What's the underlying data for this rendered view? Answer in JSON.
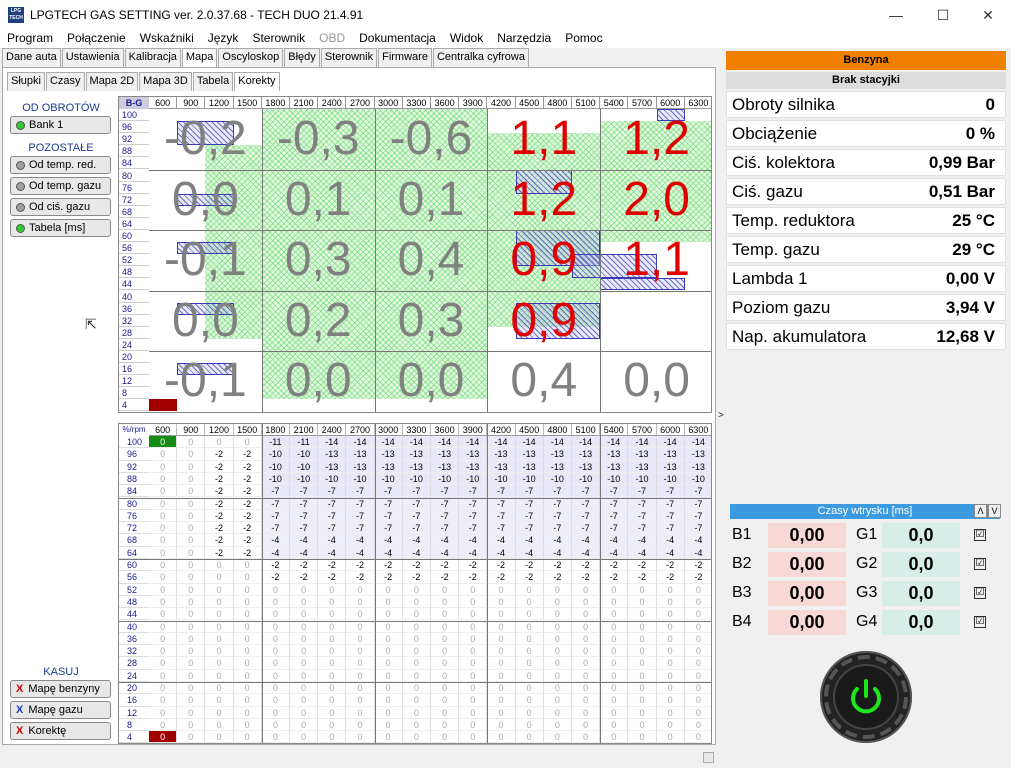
{
  "window": {
    "title": "LPGTECH GAS SETTING ver. 2.0.37.68  -  TECH DUO   21.4.91",
    "icon_text": "LPG TECH",
    "minimize": "—",
    "maximize": "☐",
    "close": "✕"
  },
  "menu": [
    "Program",
    "Połączenie",
    "Wskaźniki",
    "Język",
    "Sterownik",
    "OBD",
    "Dokumentacja",
    "Widok",
    "Narzędzia",
    "Pomoc"
  ],
  "tabs1": [
    "Dane auta",
    "Ustawienia",
    "Kalibracja",
    "Mapa",
    "Oscyloskop",
    "Błędy",
    "Sterownik",
    "Firmware",
    "Centralka cyfrowa"
  ],
  "tabs1_active": "Mapa",
  "tabs2": [
    "Słupki",
    "Czasy",
    "Mapa 2D",
    "Mapa 3D",
    "Tabela",
    "Korekty"
  ],
  "tabs2_active": "Korekty",
  "side": {
    "od_obrotow_title": "OD OBROTÓW",
    "bank_label": "Bank 1",
    "pozostale_title": "POZOSTAŁE",
    "pozostale": [
      {
        "label": "Od temp. red.",
        "dot": "gray"
      },
      {
        "label": "Od temp. gazu",
        "dot": "gray"
      },
      {
        "label": "Od ciś. gazu",
        "dot": "gray"
      },
      {
        "label": "Tabela [ms]",
        "dot": "green"
      }
    ],
    "kasuj_title": "KASUJ",
    "kasuj": [
      {
        "label": "Mapę benzyny",
        "xcolor": "#d00000"
      },
      {
        "label": "Mapę gazu",
        "xcolor": "#1a3fcf"
      },
      {
        "label": "Korektę",
        "xcolor": "#d00000"
      }
    ]
  },
  "map": {
    "corner": "B-G",
    "rpm": [
      "600",
      "900",
      "1200",
      "1500",
      "1800",
      "2100",
      "2400",
      "2700",
      "3000",
      "3300",
      "3600",
      "3900",
      "4200",
      "4500",
      "4800",
      "5100",
      "5400",
      "5700",
      "6000",
      "6300"
    ],
    "loads": [
      "100",
      "96",
      "92",
      "88",
      "84",
      "80",
      "76",
      "72",
      "68",
      "64",
      "60",
      "56",
      "52",
      "48",
      "44",
      "40",
      "36",
      "32",
      "28",
      "24",
      "20",
      "16",
      "12",
      "8",
      "4"
    ],
    "big": [
      [
        {
          "v": "-0,2",
          "c": "gray"
        },
        {
          "v": "-0,3",
          "c": "gray"
        },
        {
          "v": "-0,6",
          "c": "gray"
        },
        {
          "v": "1,1",
          "c": "red"
        },
        {
          "v": "1,2",
          "c": "red"
        }
      ],
      [
        {
          "v": "0,0",
          "c": "gray"
        },
        {
          "v": "0,1",
          "c": "gray"
        },
        {
          "v": "0,1",
          "c": "gray"
        },
        {
          "v": "1,2",
          "c": "red"
        },
        {
          "v": "2,0",
          "c": "red"
        }
      ],
      [
        {
          "v": "-0,1",
          "c": "gray"
        },
        {
          "v": "0,3",
          "c": "gray"
        },
        {
          "v": "0,4",
          "c": "gray"
        },
        {
          "v": "0,9",
          "c": "red"
        },
        {
          "v": "1,1",
          "c": "red"
        }
      ],
      [
        {
          "v": "0,0",
          "c": "gray"
        },
        {
          "v": "0,2",
          "c": "gray"
        },
        {
          "v": "0,3",
          "c": "gray"
        },
        {
          "v": "0,9",
          "c": "red"
        },
        {
          "v": "",
          "c": "gray"
        }
      ],
      [
        {
          "v": "-0,1",
          "c": "gray"
        },
        {
          "v": "0,0",
          "c": "gray"
        },
        {
          "v": "0,0",
          "c": "gray"
        },
        {
          "v": "0,4",
          "c": "gray"
        },
        {
          "v": "0,0",
          "c": "gray"
        }
      ]
    ]
  },
  "table": {
    "corner": "%/rpm",
    "rpm": [
      "600",
      "900",
      "1200",
      "1500",
      "1800",
      "2100",
      "2400",
      "2700",
      "3000",
      "3300",
      "3600",
      "3900",
      "4200",
      "4500",
      "4800",
      "5100",
      "5400",
      "5700",
      "6000",
      "6300"
    ],
    "rows": [
      {
        "load": "100",
        "vals": [
          "0",
          "0",
          "0",
          "0",
          "-11",
          "-11",
          "-14",
          "-14",
          "-14",
          "-14",
          "-14",
          "-14",
          "-14",
          "-14",
          "-14",
          "-14",
          "-14",
          "-14",
          "-14",
          "-14"
        ]
      },
      {
        "load": "96",
        "vals": [
          "0",
          "0",
          "-2",
          "-2",
          "-10",
          "-10",
          "-13",
          "-13",
          "-13",
          "-13",
          "-13",
          "-13",
          "-13",
          "-13",
          "-13",
          "-13",
          "-13",
          "-13",
          "-13",
          "-13"
        ]
      },
      {
        "load": "92",
        "vals": [
          "0",
          "0",
          "-2",
          "-2",
          "-10",
          "-10",
          "-13",
          "-13",
          "-13",
          "-13",
          "-13",
          "-13",
          "-13",
          "-13",
          "-13",
          "-13",
          "-13",
          "-13",
          "-13",
          "-13"
        ]
      },
      {
        "load": "88",
        "vals": [
          "0",
          "0",
          "-2",
          "-2",
          "-10",
          "-10",
          "-10",
          "-10",
          "-10",
          "-10",
          "-10",
          "-10",
          "-10",
          "-10",
          "-10",
          "-10",
          "-10",
          "-10",
          "-10",
          "-10"
        ]
      },
      {
        "load": "84",
        "vals": [
          "0",
          "0",
          "-2",
          "-2",
          "-7",
          "-7",
          "-7",
          "-7",
          "-7",
          "-7",
          "-7",
          "-7",
          "-7",
          "-7",
          "-7",
          "-7",
          "-7",
          "-7",
          "-7",
          "-7"
        ]
      },
      {
        "load": "80",
        "vals": [
          "0",
          "0",
          "-2",
          "-2",
          "-7",
          "-7",
          "-7",
          "-7",
          "-7",
          "-7",
          "-7",
          "-7",
          "-7",
          "-7",
          "-7",
          "-7",
          "-7",
          "-7",
          "-7",
          "-7"
        ]
      },
      {
        "load": "76",
        "vals": [
          "0",
          "0",
          "-2",
          "-2",
          "-7",
          "-7",
          "-7",
          "-7",
          "-7",
          "-7",
          "-7",
          "-7",
          "-7",
          "-7",
          "-7",
          "-7",
          "-7",
          "-7",
          "-7",
          "-7"
        ]
      },
      {
        "load": "72",
        "vals": [
          "0",
          "0",
          "-2",
          "-2",
          "-7",
          "-7",
          "-7",
          "-7",
          "-7",
          "-7",
          "-7",
          "-7",
          "-7",
          "-7",
          "-7",
          "-7",
          "-7",
          "-7",
          "-7",
          "-7"
        ]
      },
      {
        "load": "68",
        "vals": [
          "0",
          "0",
          "-2",
          "-2",
          "-4",
          "-4",
          "-4",
          "-4",
          "-4",
          "-4",
          "-4",
          "-4",
          "-4",
          "-4",
          "-4",
          "-4",
          "-4",
          "-4",
          "-4",
          "-4"
        ]
      },
      {
        "load": "64",
        "vals": [
          "0",
          "0",
          "-2",
          "-2",
          "-4",
          "-4",
          "-4",
          "-4",
          "-4",
          "-4",
          "-4",
          "-4",
          "-4",
          "-4",
          "-4",
          "-4",
          "-4",
          "-4",
          "-4",
          "-4"
        ]
      },
      {
        "load": "60",
        "vals": [
          "0",
          "0",
          "0",
          "0",
          "-2",
          "-2",
          "-2",
          "-2",
          "-2",
          "-2",
          "-2",
          "-2",
          "-2",
          "-2",
          "-2",
          "-2",
          "-2",
          "-2",
          "-2",
          "-2"
        ]
      },
      {
        "load": "56",
        "vals": [
          "0",
          "0",
          "0",
          "0",
          "-2",
          "-2",
          "-2",
          "-2",
          "-2",
          "-2",
          "-2",
          "-2",
          "-2",
          "-2",
          "-2",
          "-2",
          "-2",
          "-2",
          "-2",
          "-2"
        ]
      },
      {
        "load": "52",
        "vals": [
          "0",
          "0",
          "0",
          "0",
          "0",
          "0",
          "0",
          "0",
          "0",
          "0",
          "0",
          "0",
          "0",
          "0",
          "0",
          "0",
          "0",
          "0",
          "0",
          "0"
        ]
      },
      {
        "load": "48",
        "vals": [
          "0",
          "0",
          "0",
          "0",
          "0",
          "0",
          "0",
          "0",
          "0",
          "0",
          "0",
          "0",
          "0",
          "0",
          "0",
          "0",
          "0",
          "0",
          "0",
          "0"
        ]
      },
      {
        "load": "44",
        "vals": [
          "0",
          "0",
          "0",
          "0",
          "0",
          "0",
          "0",
          "0",
          "0",
          "0",
          "0",
          "0",
          "0",
          "0",
          "0",
          "0",
          "0",
          "0",
          "0",
          "0"
        ]
      },
      {
        "load": "40",
        "vals": [
          "0",
          "0",
          "0",
          "0",
          "0",
          "0",
          "0",
          "0",
          "0",
          "0",
          "0",
          "0",
          "0",
          "0",
          "0",
          "0",
          "0",
          "0",
          "0",
          "0"
        ]
      },
      {
        "load": "36",
        "vals": [
          "0",
          "0",
          "0",
          "0",
          "0",
          "0",
          "0",
          "0",
          "0",
          "0",
          "0",
          "0",
          "0",
          "0",
          "0",
          "0",
          "0",
          "0",
          "0",
          "0"
        ]
      },
      {
        "load": "32",
        "vals": [
          "0",
          "0",
          "0",
          "0",
          "0",
          "0",
          "0",
          "0",
          "0",
          "0",
          "0",
          "0",
          "0",
          "0",
          "0",
          "0",
          "0",
          "0",
          "0",
          "0"
        ]
      },
      {
        "load": "28",
        "vals": [
          "0",
          "0",
          "0",
          "0",
          "0",
          "0",
          "0",
          "0",
          "0",
          "0",
          "0",
          "0",
          "0",
          "0",
          "0",
          "0",
          "0",
          "0",
          "0",
          "0"
        ]
      },
      {
        "load": "24",
        "vals": [
          "0",
          "0",
          "0",
          "0",
          "0",
          "0",
          "0",
          "0",
          "0",
          "0",
          "0",
          "0",
          "0",
          "0",
          "0",
          "0",
          "0",
          "0",
          "0",
          "0"
        ]
      },
      {
        "load": "20",
        "vals": [
          "0",
          "0",
          "0",
          "0",
          "0",
          "0",
          "0",
          "0",
          "0",
          "0",
          "0",
          "0",
          "0",
          "0",
          "0",
          "0",
          "0",
          "0",
          "0",
          "0"
        ]
      },
      {
        "load": "16",
        "vals": [
          "0",
          "0",
          "0",
          "0",
          "0",
          "0",
          "0",
          "0",
          "0",
          "0",
          "0",
          "0",
          "0",
          "0",
          "0",
          "0",
          "0",
          "0",
          "0",
          "0"
        ]
      },
      {
        "load": "12",
        "vals": [
          "0",
          "0",
          "0",
          "0",
          "0",
          "0",
          "0",
          "0",
          "0",
          "0",
          "0",
          "0",
          "0",
          "0",
          "0",
          "0",
          "0",
          "0",
          "0",
          "0"
        ]
      },
      {
        "load": "8",
        "vals": [
          "0",
          "0",
          "0",
          "0",
          "0",
          "0",
          "0",
          "0",
          "0",
          "0",
          "0",
          "0",
          "0",
          "0",
          "0",
          "0",
          "0",
          "0",
          "0",
          "0"
        ]
      },
      {
        "load": "4",
        "vals": [
          "0",
          "0",
          "0",
          "0",
          "0",
          "0",
          "0",
          "0",
          "0",
          "0",
          "0",
          "0",
          "0",
          "0",
          "0",
          "0",
          "0",
          "0",
          "0",
          "0"
        ]
      }
    ]
  },
  "status": {
    "fuel": "Benzyna",
    "station": "Brak stacyjki",
    "fuel_color": "#f28000"
  },
  "params": [
    {
      "label": "Obroty silnika",
      "value": "0"
    },
    {
      "label": "Obciążenie",
      "value": "0 %"
    },
    {
      "label": "Ciś. kolektora",
      "value": "0,99 Bar"
    },
    {
      "label": "Ciś. gazu",
      "value": "0,51 Bar"
    },
    {
      "label": "Temp. reduktora",
      "value": "25 °C"
    },
    {
      "label": "Temp. gazu",
      "value": "29 °C"
    },
    {
      "label": "Lambda 1",
      "value": "0,00 V"
    },
    {
      "label": "Poziom gazu",
      "value": "3,94 V"
    },
    {
      "label": "Nap. akumulatora",
      "value": "12,68 V"
    }
  ],
  "injection": {
    "title": "Czasy wtrysku [ms]",
    "up": "Λ",
    "down": "V",
    "rows": [
      {
        "b": "B1",
        "bv": "0,00",
        "g": "G1",
        "gv": "0,0",
        "checked": "☑"
      },
      {
        "b": "B2",
        "bv": "0,00",
        "g": "G2",
        "gv": "0,0",
        "checked": "☑"
      },
      {
        "b": "B3",
        "bv": "0,00",
        "g": "G3",
        "gv": "0,0",
        "checked": "☑"
      },
      {
        "b": "B4",
        "bv": "0,00",
        "g": "G4",
        "gv": "0,0",
        "checked": "☑"
      }
    ]
  },
  "colors": {
    "red": "#e00000",
    "gray": "#808080",
    "green_hatch": "#5fd35f",
    "blue_hatch": "#3a3ab5",
    "active_cell": "#148c14",
    "inactive_cell": "#a00000"
  },
  "icons": {
    "power": "power-icon",
    "sidebar_arrow": "chevron-right-icon"
  }
}
